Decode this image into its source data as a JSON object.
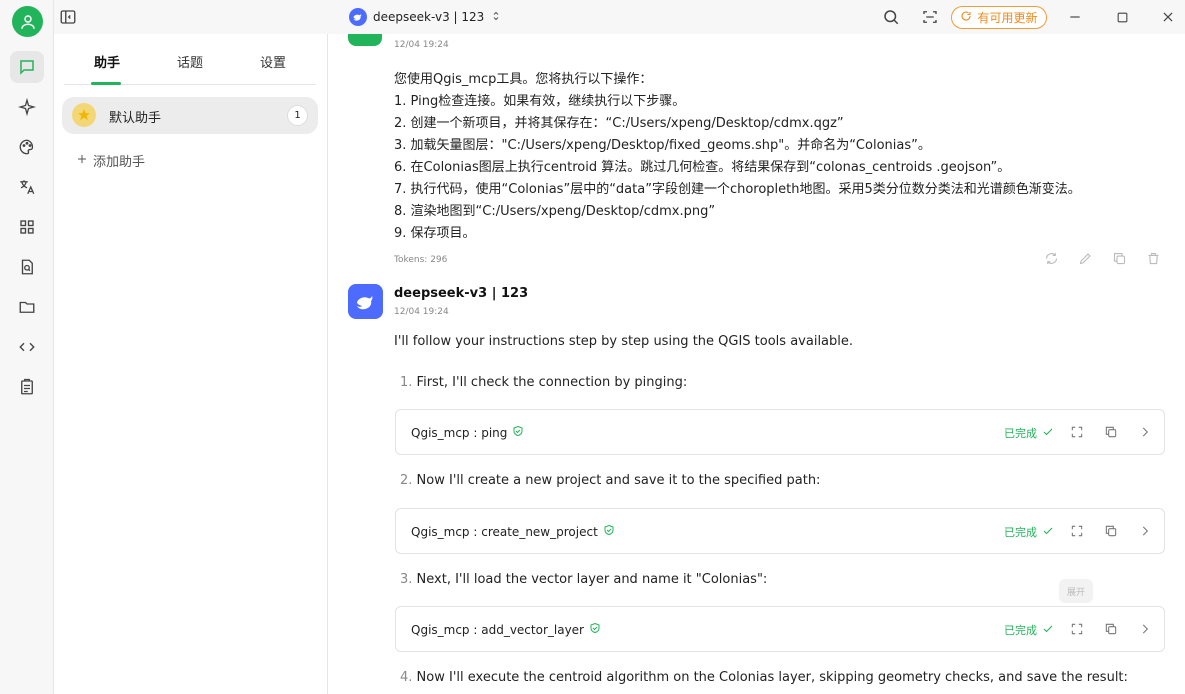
{
  "titlebar": {
    "model_title": "deepseek-v3 | 123",
    "update_label": "有可用更新"
  },
  "panel": {
    "tabs": [
      {
        "label": "助手"
      },
      {
        "label": "话题"
      },
      {
        "label": "设置"
      }
    ],
    "assistant": {
      "name": "默认助手",
      "count": "1"
    },
    "add_label": "添加助手"
  },
  "user_message": {
    "time": "12/04 19:24",
    "lines": [
      "您使用Qgis_mcp工具。您将执行以下操作：",
      "1. Ping检查连接。如果有效，继续执行以下步骤。",
      "2. 创建一个新项目，并将其保存在：“C:/Users/xpeng/Desktop/cdmx.qgz”",
      "3. 加载矢量图层：\"C:/Users/xpeng/Desktop/fixed_geoms.shp\"。并命名为“Colonias”。",
      "6. 在Colonias图层上执行centroid 算法。跳过几何检查。将结果保存到“colonas_centroids .geojson”。",
      "7. 执行代码，使用“Colonias”层中的“data”字段创建一个choropleth地图。采用5类分位数分类法和光谱颜色渐变法。",
      "8. 渲染地图到“C:/Users/xpeng/Desktop/cdmx.png”",
      "9. 保存项目。"
    ],
    "tokens": "Tokens: 296"
  },
  "assistant_message": {
    "name": "deepseek-v3 | 123",
    "time": "12/04 19:24",
    "intro": "I'll follow your instructions step by step using the QGIS tools available.",
    "steps": [
      {
        "num": "1.",
        "text": "First, I'll check the connection by pinging:"
      },
      {
        "num": "2.",
        "text": "Now I'll create a new project and save it to the specified path:"
      },
      {
        "num": "3.",
        "text": "Next, I'll load the vector layer and name it \"Colonias\":"
      },
      {
        "num": "4.",
        "text": "Now I'll execute the centroid algorithm on the Colonias layer, skipping geometry checks, and save the result:"
      }
    ],
    "tools": [
      {
        "name": "Qgis_mcp : ping",
        "status": "已完成"
      },
      {
        "name": "Qgis_mcp : create_new_project",
        "status": "已完成"
      },
      {
        "name": "Qgis_mcp : add_vector_layer",
        "status": "已完成"
      }
    ],
    "tooltip": "展开"
  },
  "colors": {
    "accent": "#22b45a",
    "deepseek": "#4d6bfe",
    "update": "#f08a1c"
  }
}
